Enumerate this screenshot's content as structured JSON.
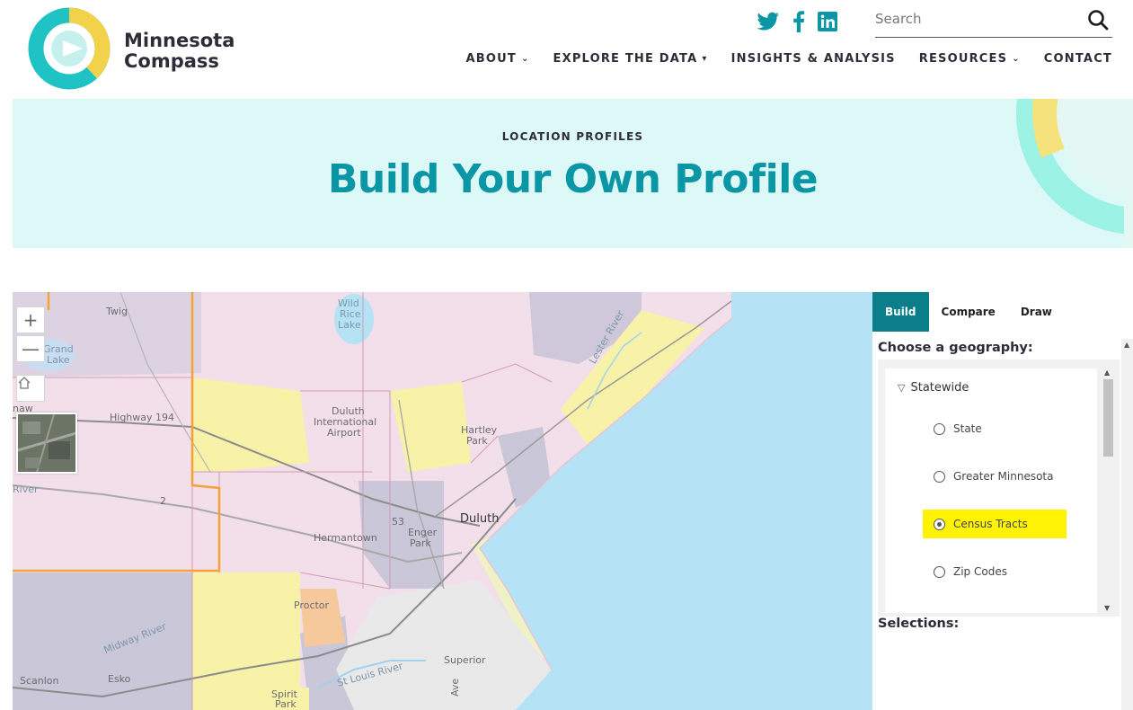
{
  "brand": {
    "name_line1": "Minnesota",
    "name_line2": "Compass"
  },
  "social": [
    "twitter-icon",
    "facebook-icon",
    "linkedin-icon"
  ],
  "search": {
    "placeholder": "Search",
    "value": ""
  },
  "nav": [
    {
      "label": "ABOUT",
      "dropdown": true
    },
    {
      "label": "EXPLORE THE DATA",
      "dropdown": true
    },
    {
      "label": "INSIGHTS & ANALYSIS",
      "dropdown": false
    },
    {
      "label": "RESOURCES",
      "dropdown": true
    },
    {
      "label": "CONTACT",
      "dropdown": false
    }
  ],
  "hero": {
    "kicker": "LOCATION PROFILES",
    "title": "Build Your Own Profile"
  },
  "map": {
    "labels": {
      "twig": "Twig",
      "wild": "Wild",
      "rice": "Rice",
      "lake": "Lake",
      "grand": "Grand",
      "grand_lake": "Lake",
      "highway": "Highway 194",
      "duluth_intl1": "Duluth",
      "duluth_intl2": "International",
      "duluth_intl3": "Airport",
      "hartley1": "Hartley",
      "hartley2": "Park",
      "lester": "Lester River",
      "naw": "naw",
      "river_left": "River",
      "two": "2",
      "fiftythree": "53",
      "duluth": "Duluth",
      "hermantown": "Hermantown",
      "enger1": "Enger",
      "enger2": "Park",
      "proctor": "Proctor",
      "midway": "Midway River",
      "stlouis": "St Louis River",
      "superior": "Superior",
      "esko": "Esko",
      "scanlon": "Scanlon",
      "spirit1": "Spirit",
      "spirit2": "Park",
      "ave": "Ave"
    },
    "colors": {
      "water": "#b5e2f4",
      "pink": "#f3dfe9",
      "yellow": "#f8f2a8",
      "gray": "#c9c7d8",
      "orange_border": "#f5a13a"
    }
  },
  "panel": {
    "tabs": [
      {
        "label": "Build",
        "active": true
      },
      {
        "label": "Compare",
        "active": false
      },
      {
        "label": "Draw",
        "active": false
      }
    ],
    "choose_label": "Choose a geography:",
    "group": "Statewide",
    "options": [
      {
        "label": "State",
        "selected": false
      },
      {
        "label": "Greater Minnesota",
        "selected": false
      },
      {
        "label": "Census Tracts",
        "selected": true
      },
      {
        "label": "Zip Codes",
        "selected": false
      }
    ],
    "selections_label": "Selections:"
  },
  "colors": {
    "accent_teal": "#0a96a5",
    "tab_active": "#0a7f89",
    "hero_bg": "#dcf8f7",
    "highlight": "#fff203"
  }
}
